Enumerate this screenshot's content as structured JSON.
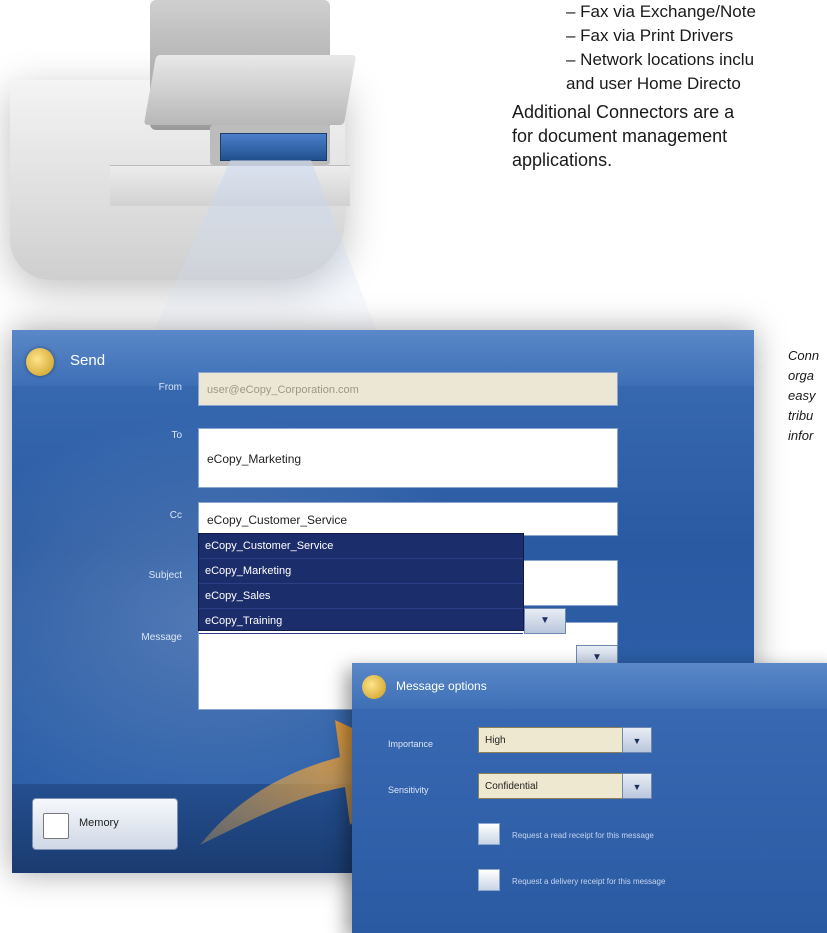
{
  "bullets": [
    "– Fax via Exchange/Note",
    "– Fax via Print Drivers",
    "– Network locations inclu",
    "   and user Home Directo"
  ],
  "paragraph": [
    "Additional Connectors are a",
    "for document management",
    "applications."
  ],
  "caption": [
    "Conn",
    "orga",
    "easy",
    "tribu",
    "infor"
  ],
  "send_window": {
    "title": "Send",
    "labels": {
      "from": "From",
      "to": "To",
      "cc": "Cc",
      "subject": "Subject",
      "message": "Message"
    },
    "from_value": "user@eCopy_Corporation.com",
    "to_value": "eCopy_Marketing",
    "cc_value": "eCopy_Customer_Service",
    "dropdown_options": [
      "eCopy_Customer_Service",
      "eCopy_Marketing",
      "eCopy_Sales",
      "eCopy_Training"
    ],
    "memory_button": "Memory"
  },
  "message_dialog": {
    "title": "Message options",
    "importance_label": "Importance",
    "importance_value": "High",
    "sensitivity_label": "Sensitivity",
    "sensitivity_value": "Confidential",
    "checkbox1_label": "Request a read receipt for this message",
    "checkbox2_label": "Request a delivery receipt for this message"
  },
  "colors": {
    "window_blue": "#2f63ad",
    "dropdown_navy": "#1c2d6c",
    "arrow_orange": "#f39a22"
  }
}
